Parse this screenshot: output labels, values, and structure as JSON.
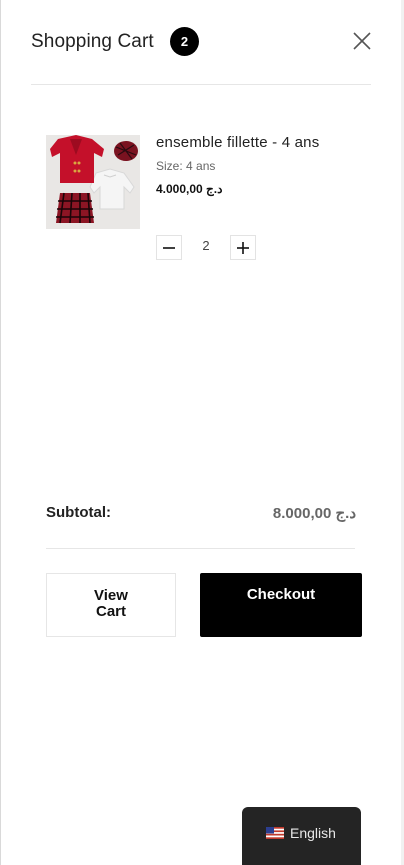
{
  "header": {
    "title": "Shopping Cart",
    "count": "2",
    "close_icon": "close-icon"
  },
  "cart": {
    "items": [
      {
        "name": "ensemble fillette - 4 ans",
        "meta": "Size: 4 ans",
        "price": "4.000,00 د.ج",
        "quantity": "2",
        "image_icon": "product-thumbnail"
      }
    ]
  },
  "summary": {
    "subtotal_label": "Subtotal:",
    "subtotal_value": "8.000,00 د.ج"
  },
  "actions": {
    "view_cart_label": "View Cart",
    "checkout_label": "Checkout"
  },
  "language": {
    "label": "English",
    "flag_icon": "us-flag-icon"
  },
  "colors": {
    "accent": "#000000",
    "badge_bg": "#000000",
    "language_bg": "#242424"
  }
}
